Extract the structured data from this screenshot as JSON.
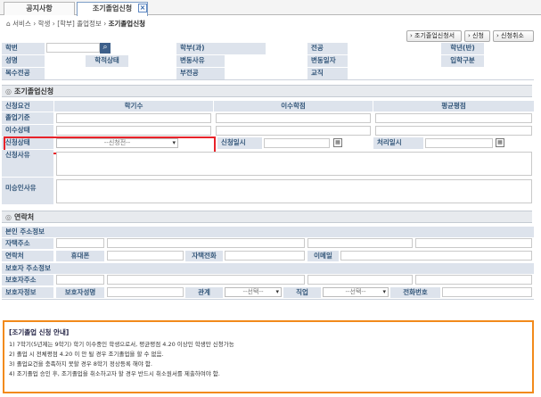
{
  "tabs": [
    {
      "label": "공지사항"
    },
    {
      "label": "조기졸업신청"
    }
  ],
  "breadcrumb": {
    "path": "서비스 › 학생 › [학부] 졸업정보 ›",
    "current": "조기졸업신청"
  },
  "buttons": {
    "print": "조기졸업신청서",
    "apply": "신청",
    "cancel": "신청취소"
  },
  "student": {
    "student_id": "학번",
    "dept": "학부(과)",
    "major": "전공",
    "grade": "학년(반)",
    "name": "성명",
    "status": "학적상태",
    "change_reason": "변동사유",
    "change_date": "변동일자",
    "admission_type": "입학구분",
    "double_major": "복수전공",
    "minor": "부전공",
    "teaching": "교직"
  },
  "apply_section": {
    "title": "조기졸업신청",
    "condition": "신청요건",
    "col_semesters": "학기수",
    "col_credits": "이수학점",
    "col_gpa": "평균평점",
    "criteria": "졸업기준",
    "completed": "이수상태",
    "apply_status": "신청상태",
    "apply_status_value": "--신청전--",
    "apply_date": "신청일시",
    "process_date": "처리일시",
    "reason": "신청사유",
    "reject_reason": "미승인사유"
  },
  "contact_section": {
    "title": "연락처",
    "personal_info": "본인 주소정보",
    "home_address": "자택주소",
    "contact": "연락처",
    "mobile": "휴대폰",
    "home_phone": "자택전화",
    "email": "이메일",
    "guardian_info": "보호자 주소정보",
    "guardian_address": "보호자주소",
    "guardian_name": "보호자정보",
    "guardian_name2": "보호자성명",
    "relation": "관계",
    "relation_value": "--선택--",
    "job": "직업",
    "job_value": "--선택--",
    "phone_number": "전화번호"
  },
  "notice": {
    "title": "[조기졸업 신청 안내]",
    "lines": [
      "1) 7학기(5년제는 9학기) 학기 이수중인 학생으로서, 평균평점 4.20 이상인 학생만 신청가능",
      "2) 졸업 시 전체평점 4.20 이 안 될 경우 조기졸업을 할 수 없음.",
      "3) 졸업요건을 충족하지 못할 경우 8학기 정상등록 해야 함.",
      "4) 조기졸업 승인 후, 조기졸업을 취소하고자 할 경우 반드시 취소원서를 제출하여야 함."
    ]
  },
  "colors": {
    "highlight": "#e8232a",
    "notice_border": "#f28a1b",
    "label_bg": "#dde3ec"
  }
}
